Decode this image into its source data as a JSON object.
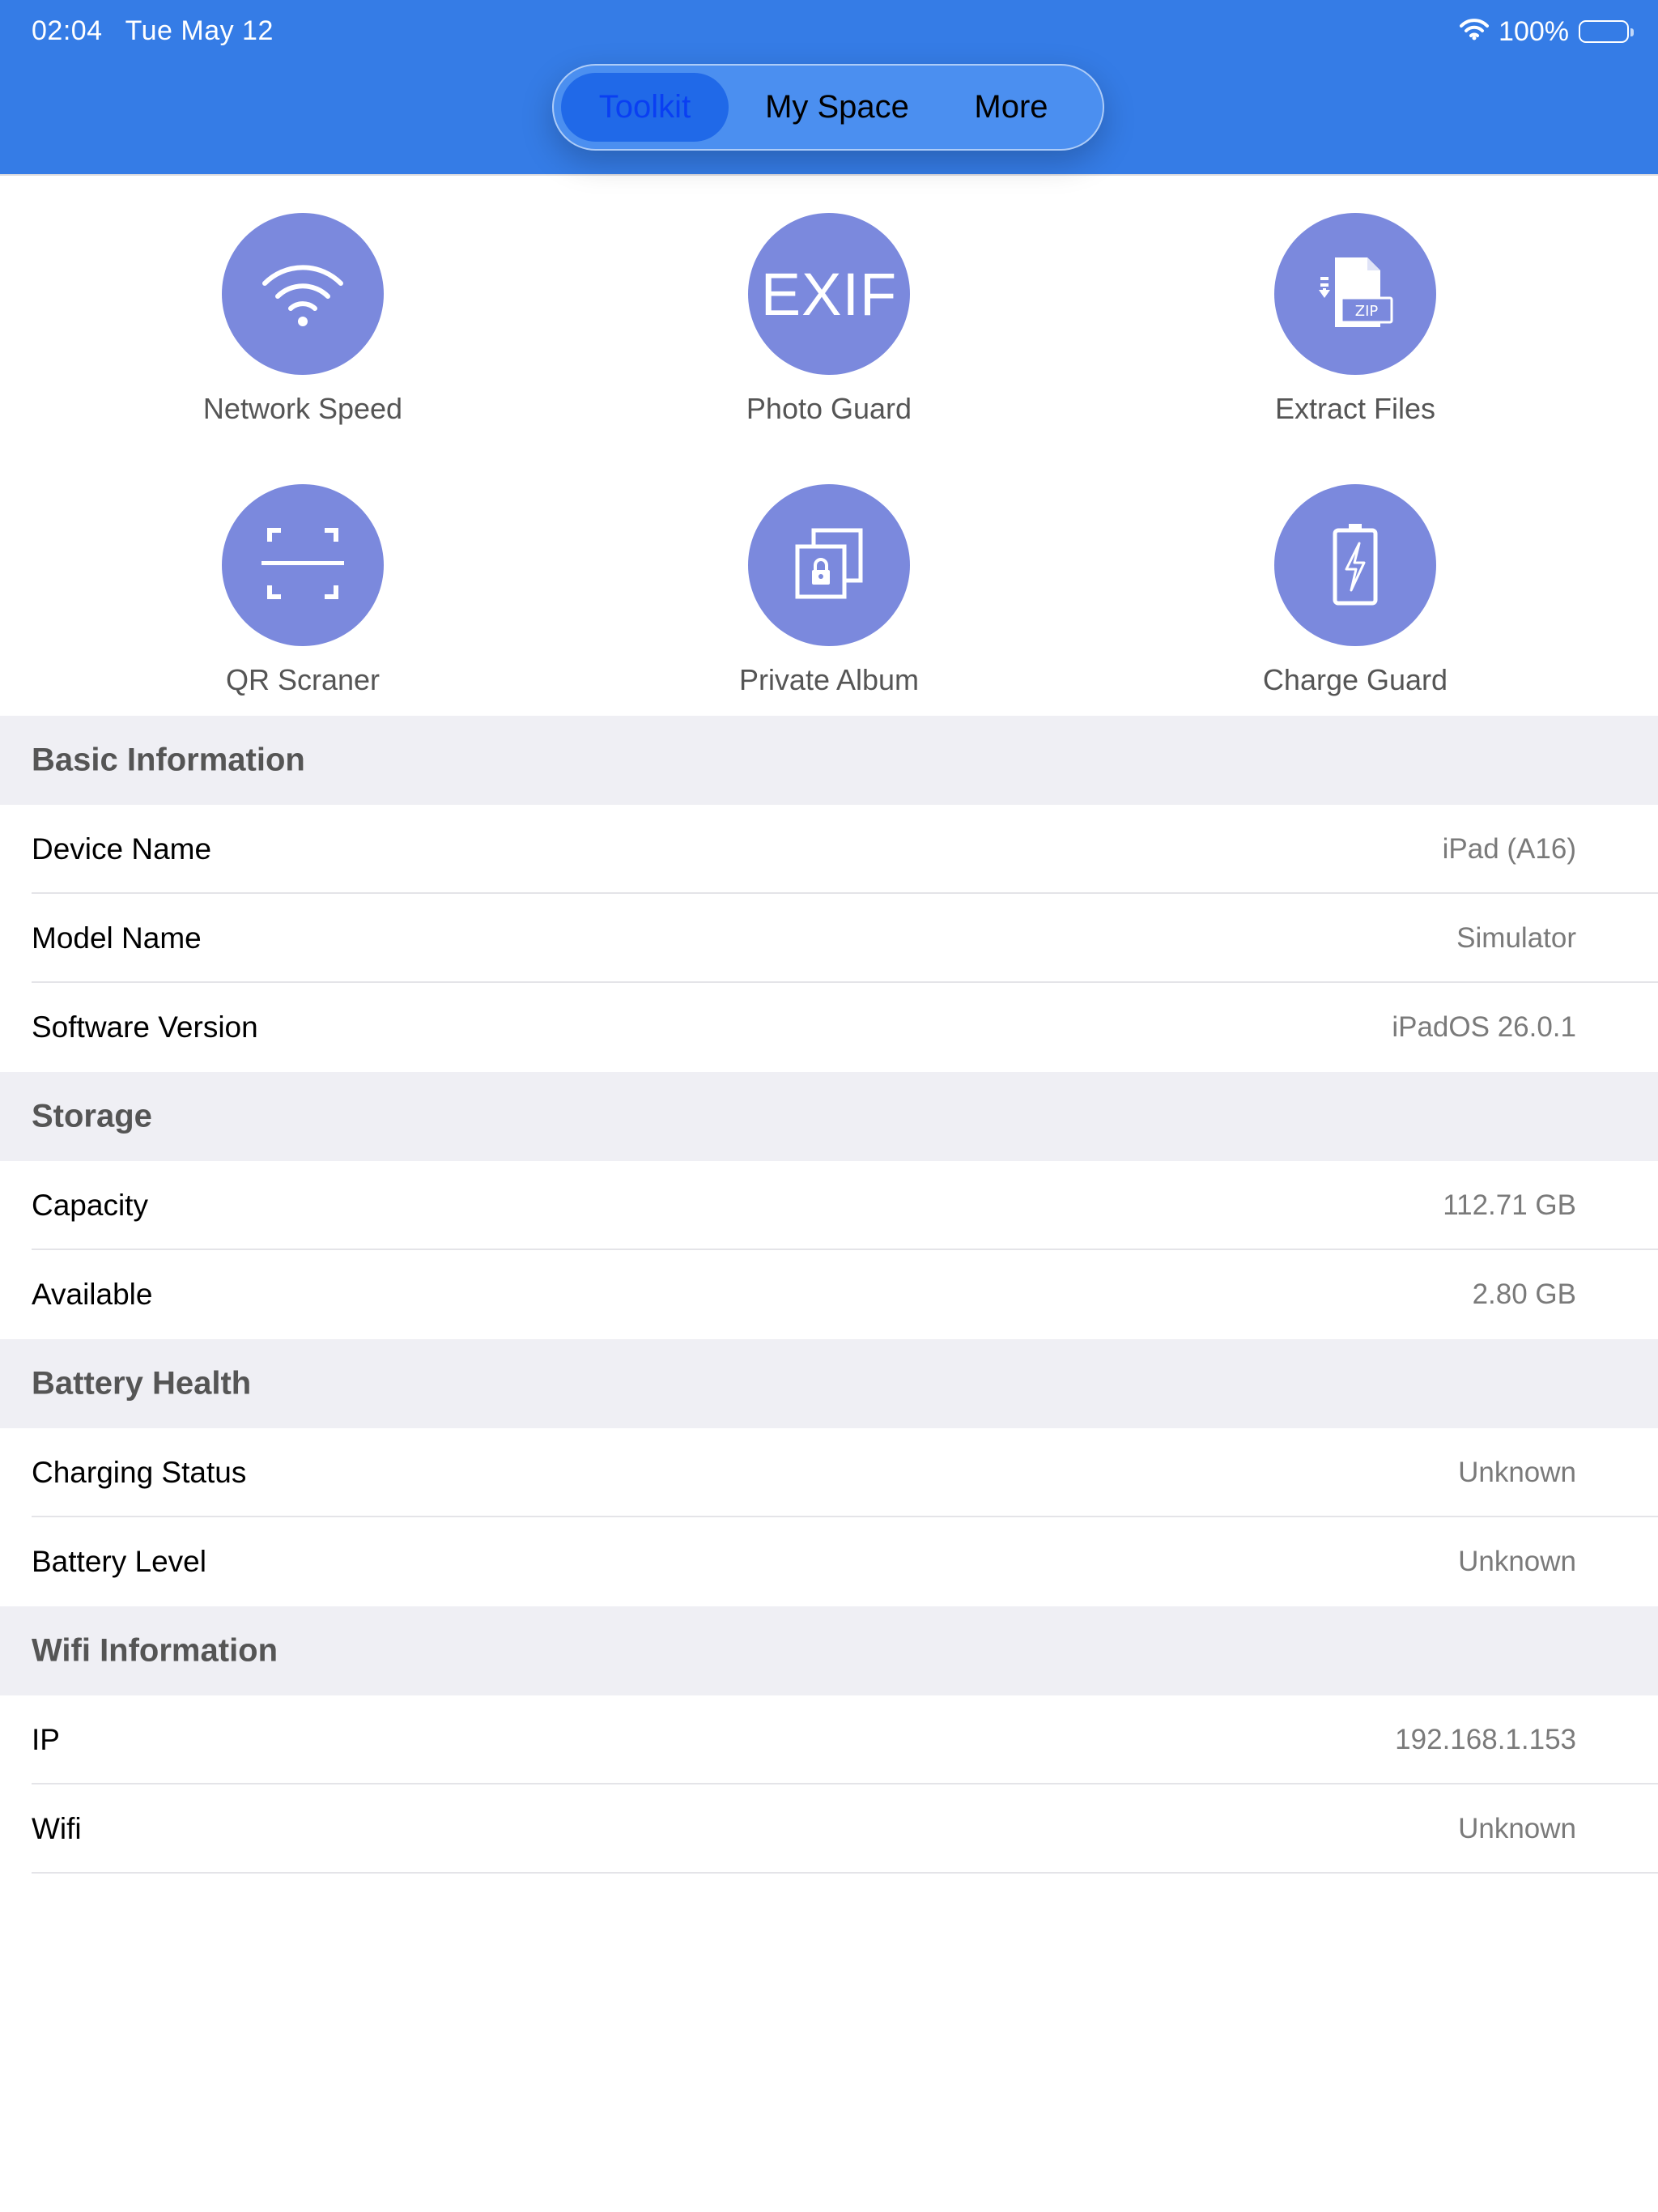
{
  "status_bar": {
    "time": "02:04",
    "date": "Tue May 12",
    "battery_percent": "100%",
    "battery_level": 1.0
  },
  "segmented_control": {
    "items": [
      {
        "label": "Toolkit",
        "selected": true
      },
      {
        "label": "My Space",
        "selected": false
      },
      {
        "label": "More",
        "selected": false
      }
    ]
  },
  "tools": [
    {
      "label": "Network Speed",
      "icon": "wifi-icon"
    },
    {
      "label": "Photo Guard",
      "icon": "exif-icon",
      "icon_text": "EXIF"
    },
    {
      "label": "Extract Files",
      "icon": "zip-file-icon",
      "icon_text": "ZIP"
    },
    {
      "label": "QR Scraner",
      "icon": "qr-scanner-icon"
    },
    {
      "label": "Private Album",
      "icon": "private-album-icon"
    },
    {
      "label": "Charge Guard",
      "icon": "battery-charge-icon"
    }
  ],
  "sections": [
    {
      "title": "Basic Information",
      "rows": [
        {
          "label": "Device Name",
          "value": "iPad (A16)"
        },
        {
          "label": "Model Name",
          "value": "Simulator"
        },
        {
          "label": "Software Version",
          "value": "iPadOS 26.0.1"
        }
      ]
    },
    {
      "title": "Storage",
      "rows": [
        {
          "label": "Capacity",
          "value": "112.71 GB"
        },
        {
          "label": "Available",
          "value": "2.80 GB"
        }
      ]
    },
    {
      "title": "Battery Health",
      "rows": [
        {
          "label": "Charging Status",
          "value": "Unknown"
        },
        {
          "label": "Battery Level",
          "value": "Unknown"
        }
      ]
    },
    {
      "title": "Wifi Information",
      "rows": [
        {
          "label": "IP",
          "value": "192.168.1.153"
        },
        {
          "label": "Wifi",
          "value": "Unknown"
        }
      ]
    }
  ],
  "colors": {
    "header": "#357ce6",
    "tool_circle": "#7b89dd",
    "selected_segment": "#2069e8",
    "section_background": "#efeff4"
  }
}
